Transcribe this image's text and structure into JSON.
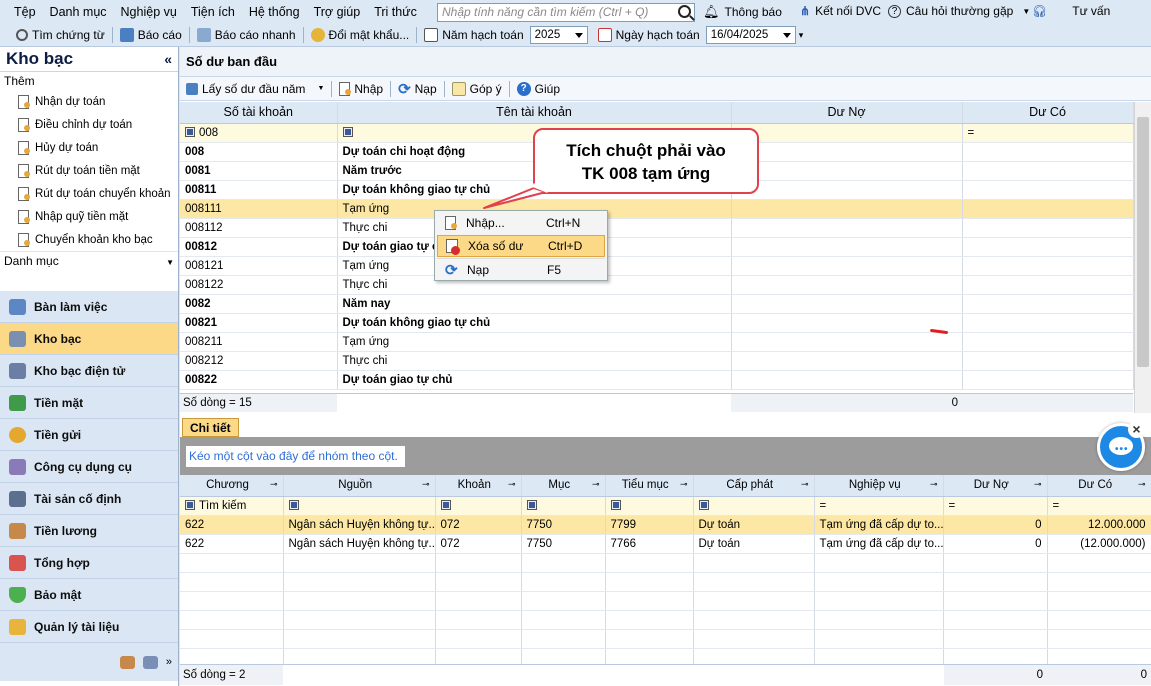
{
  "menubar": {
    "items": [
      "Tệp",
      "Danh mục",
      "Nghiệp vụ",
      "Tiện ích",
      "Hệ thống",
      "Trợ giúp",
      "Tri thức"
    ],
    "search_placeholder": "Nhập tính năng cần tìm kiếm (Ctrl + Q)",
    "notify": "Thông báo",
    "connect": "Kết nối DVC",
    "faq": "Câu hỏi thường gặp",
    "consult": "Tư vấn"
  },
  "toolbar": {
    "find": "Tìm chứng từ",
    "report": "Báo cáo",
    "quick_report": "Báo cáo nhanh",
    "change_pass": "Đổi mật khẩu...",
    "year_label": "Năm hạch toán",
    "year_value": "2025",
    "date_label": "Ngày hạch toán",
    "date_value": "16/04/2025"
  },
  "sidebar": {
    "title": "Kho bạc",
    "section_add": "Thêm",
    "items": [
      "Nhận dự toán",
      "Điều chỉnh dự toán",
      "Hủy dự toán",
      "Rút dự toán tiền mặt",
      "Rút dự toán chuyển khoản",
      "Nhập quỹ tiền mặt",
      "Chuyển khoản kho bạc"
    ],
    "section_cat": "Danh mục",
    "nav": [
      "Bàn làm việc",
      "Kho bạc",
      "Kho bạc điện tử",
      "Tiền mặt",
      "Tiền gửi",
      "Công cụ dụng cụ",
      "Tài sản cố định",
      "Tiền lương",
      "Tổng hợp",
      "Bảo mật",
      "Quản lý tài liệu"
    ]
  },
  "main": {
    "title": "Số dư ban đầu",
    "tools": {
      "get": "Lấy số dư đầu năm",
      "import": "Nhập",
      "reload": "Nạp",
      "feedback": "Góp ý",
      "help": "Giúp"
    },
    "columns": [
      "Số tài khoản",
      "Tên tài khoản",
      "Dư Nợ",
      "Dư Có"
    ],
    "filter_account": "008",
    "rows": [
      {
        "acc": "008",
        "name": "Dự toán chi hoạt động",
        "bold": true
      },
      {
        "acc": "0081",
        "name": "Năm trước",
        "bold": true
      },
      {
        "acc": "00811",
        "name": "Dự toán không giao tự chủ",
        "bold": true
      },
      {
        "acc": "008111",
        "name": "Tạm ứng",
        "bold": false
      },
      {
        "acc": "008112",
        "name": "Thực chi",
        "bold": false
      },
      {
        "acc": "00812",
        "name": "Dự toán giao tự chủ",
        "bold": true
      },
      {
        "acc": "008121",
        "name": "Tạm ứng",
        "bold": false
      },
      {
        "acc": "008122",
        "name": "Thực chi",
        "bold": false
      },
      {
        "acc": "0082",
        "name": "Năm nay",
        "bold": true
      },
      {
        "acc": "00821",
        "name": "Dự toán không giao tự chủ",
        "bold": true
      },
      {
        "acc": "008211",
        "name": "Tạm ứng",
        "bold": false
      },
      {
        "acc": "008212",
        "name": "Thực chi",
        "bold": false
      },
      {
        "acc": "00822",
        "name": "Dự toán giao tự chủ",
        "bold": true
      }
    ],
    "footer_count": "Số dòng = 15",
    "footer_debit": "0"
  },
  "callout": {
    "line1": "Tích chuột phải vào",
    "line2": "TK 008 tạm ứng"
  },
  "context_menu": [
    {
      "label": "Nhập...",
      "shortcut": "Ctrl+N"
    },
    {
      "label": "Xóa số dư",
      "shortcut": "Ctrl+D"
    },
    {
      "label": "Nạp",
      "shortcut": "F5"
    }
  ],
  "detail": {
    "tab": "Chi tiết",
    "group_hint": "Kéo một cột vào đây để nhóm theo cột.",
    "columns": [
      "Chương",
      "Nguồn",
      "Khoản",
      "Mục",
      "Tiểu mục",
      "Cấp phát",
      "Nghiệp vụ",
      "Dư Nợ",
      "Dư Có"
    ],
    "filter_search": "Tìm kiếm",
    "rows": [
      [
        "622",
        "Ngân sách Huyện không tự...",
        "072",
        "7750",
        "7799",
        "Dự toán",
        "Tạm ứng đã cấp dự to...",
        "0",
        "12.000.000"
      ],
      [
        "622",
        "Ngân sách Huyện không tự...",
        "072",
        "7750",
        "7766",
        "Dự toán",
        "Tạm ứng đã cấp dự to...",
        "0",
        "(12.000.000)"
      ]
    ],
    "footer_count": "Số dòng = 2",
    "footer_debit": "0",
    "footer_credit": "0"
  },
  "colors": {
    "accent": "#fbd987",
    "callout_border": "#e0414c",
    "chat": "#1e88e5"
  }
}
